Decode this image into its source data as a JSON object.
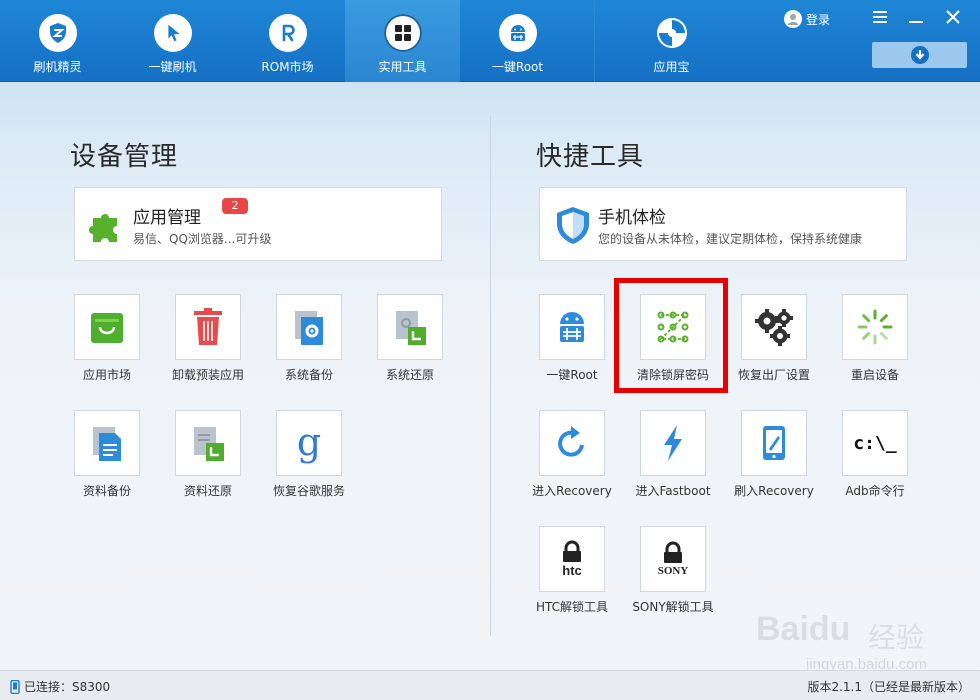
{
  "nav": {
    "items": [
      {
        "label": "刷机精灵"
      },
      {
        "label": "一键刷机"
      },
      {
        "label": "ROM市场"
      },
      {
        "label": "实用工具",
        "active": true
      },
      {
        "label": "一键Root"
      },
      {
        "label": "应用宝"
      }
    ],
    "login_label": "登录"
  },
  "left": {
    "title": "设备管理",
    "card": {
      "title": "应用管理",
      "subtitle": "易信、QQ浏览器...可升级",
      "badge": "2"
    },
    "tools": [
      {
        "label": "应用市场"
      },
      {
        "label": "卸载预装应用"
      },
      {
        "label": "系统备份"
      },
      {
        "label": "系统还原"
      },
      {
        "label": "资料备份"
      },
      {
        "label": "资料还原"
      },
      {
        "label": "恢复谷歌服务"
      }
    ]
  },
  "right": {
    "title": "快捷工具",
    "card": {
      "title": "手机体检",
      "subtitle": "您的设备从未体检，建议定期体检，保持系统健康"
    },
    "tools": [
      {
        "label": "一键Root"
      },
      {
        "label": "清除锁屏密码"
      },
      {
        "label": "恢复出厂设置"
      },
      {
        "label": "重启设备"
      },
      {
        "label": "进入Recovery"
      },
      {
        "label": "进入Fastboot"
      },
      {
        "label": "刷入Recovery"
      },
      {
        "label": "Adb命令行"
      },
      {
        "label": "HTC解锁工具"
      },
      {
        "label": "SONY解锁工具"
      }
    ],
    "adb_glyph": "c:\\_",
    "htc_glyph": "htc",
    "sony_glyph": "SONY"
  },
  "status": {
    "connected": "已连接：S8300",
    "version": "版本2.1.1（已经是最新版本）"
  },
  "watermark": {
    "brand": "Baidu",
    "cn": "经验",
    "url": "jingyan.baidu.com"
  },
  "colors": {
    "accent": "#1a7ccd",
    "highlight": "#e60000",
    "badge": "#e84747"
  }
}
